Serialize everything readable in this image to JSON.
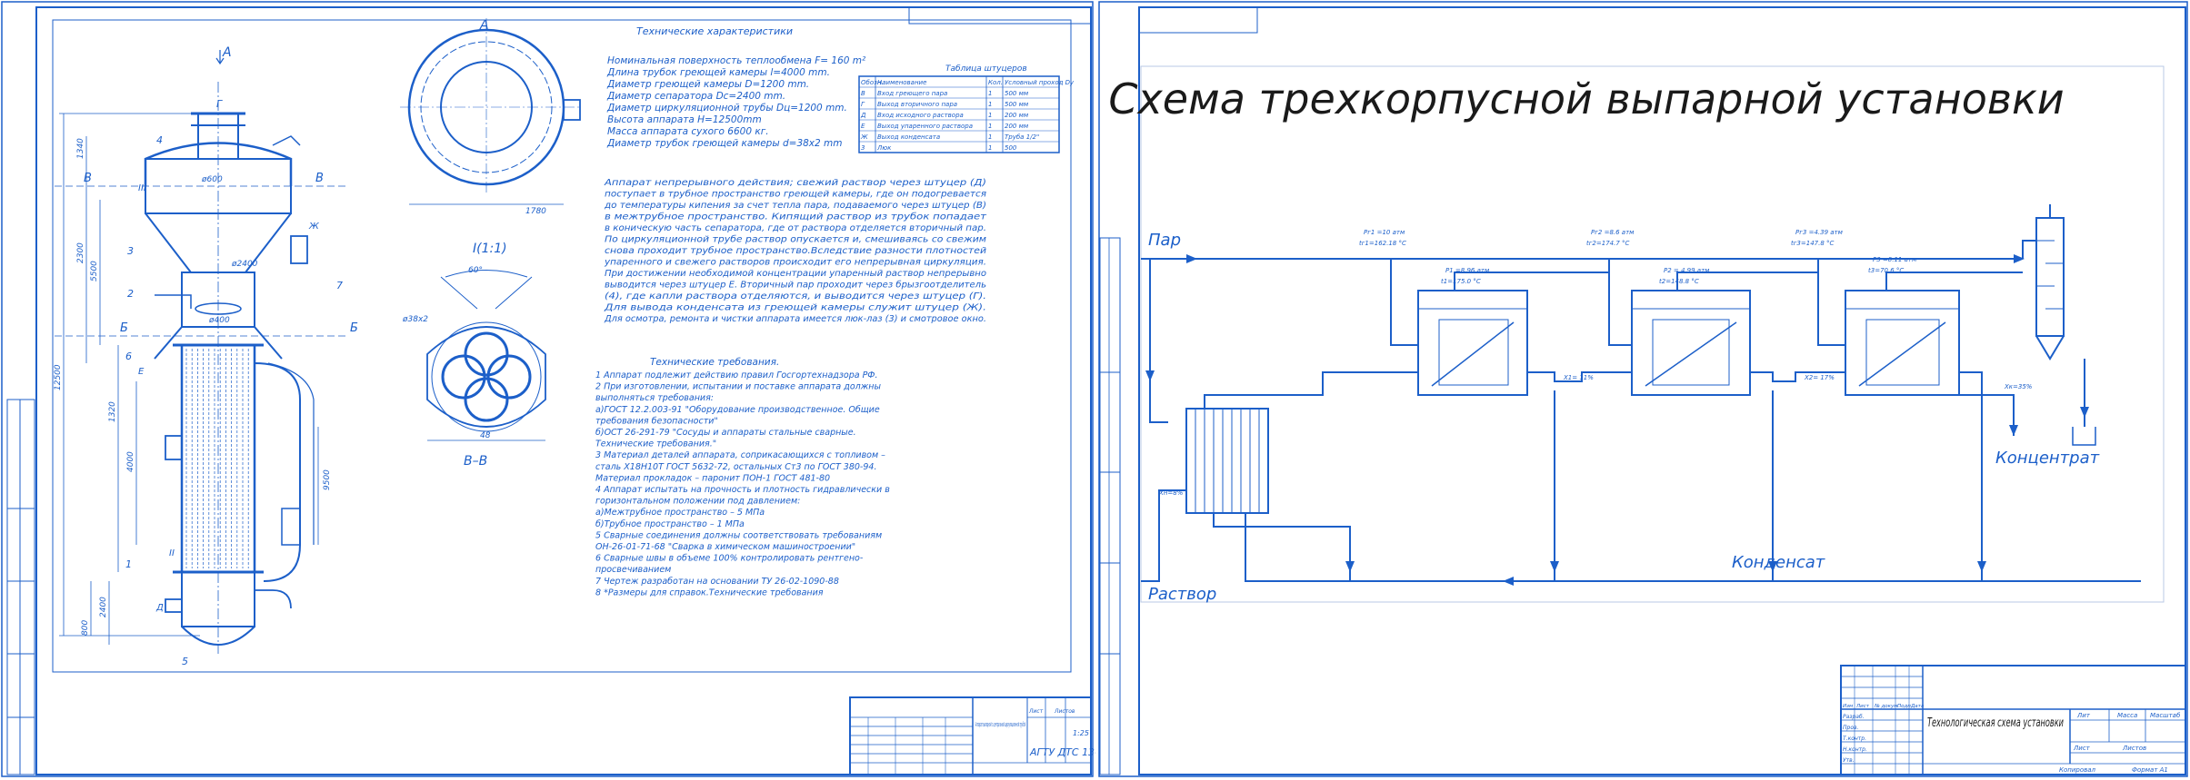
{
  "sheet1": {
    "section_marks": {
      "a_arrow": "A",
      "a_top": "A",
      "v_left": "B",
      "v_right": "B",
      "b_left": "Б",
      "b_right": "Б",
      "g": "Г",
      "e": "E",
      "d": "Д",
      "zh": "Ж",
      "view": "I(1:1)",
      "vv": "B–B"
    },
    "tech_title": "Технические характеристики",
    "specs": [
      "Номинальная поверхность теплообмена F= 160 m²",
      "Длина трубок греющей камеры l=4000 mm.",
      "Диаметр греющей камеры D=1200 mm.",
      "Диаметр сепаратора Dс=2400 mm.",
      "Диаметр циркуляционной трубы Dц=1200 mm.",
      "Высота аппарата H=12500mm",
      "Масса аппарата сухого 6600 кг.",
      "Диаметр трубок греющей камеры d=38x2 mm"
    ],
    "description": [
      "Аппарат непрерывного действия; свежий раствор через штуцер (Д)",
      "поступает в трубное пространство греющей камеры, где он подогревается",
      "до температуры кипения за счет тепла пара, подаваемого через штуцер (В)",
      "в межтрубное пространство. Кипящий раствор из трубок попадает",
      "в коническую часть сепаратора, где от раствора отделяется вторичный пар.",
      "По циркуляционной трубе раствор опускается и, смешиваясь со свежим",
      "снова проходит трубное пространство.Вследствие разности плотностей",
      "упаренного и свежего растворов происходит его непрерывная циркуляция.",
      "При достижении необходимой концентрации упаренный раствор непрерывно",
      "выводится через штуцер Е. Вторичный пар проходит через брызгоотделитель",
      "(4), где капли раствора отделяются, и выводится через штуцер (Г).",
      "Для вывода конденсата из греющей камеры служит штуцер (Ж).",
      "Для осмотра, ремонта и чистки аппарата имеется люк-лаз (3) и смотровое окно."
    ],
    "req_title": "Технические требования.",
    "requirements": [
      "1 Аппарат подлежит действию правил Госгортехнадзора РФ.",
      "2 При изготовлении, испытании и поставке аппарата должны",
      "выполняться требования:",
      "    а)ГОСТ 12.2.003-91 \"Оборудование производственное. Общие",
      "    требования безопасности\"",
      "    б)ОСТ 26-291-79 \"Сосуды и аппараты стальные сварные.",
      "Технические требования.\"",
      "3 Материал деталей аппарата, соприкасающихся с топливом –",
      "сталь Х18Н10Т ГОСТ 5632-72, остальных Ст3 по ГОСТ 380-94.",
      "Материал прокладок – паронит ПОН-1 ГОСТ 481-80",
      "4 Аппарат испытать на прочность и плотность гидравлически в",
      "горизонтальном положении под давлением:",
      "    а)Межтрубное пространство –   5 МПа",
      "    б)Трубное пространство –      1 МПа",
      "5 Сварные соединения должны соответствовать требованиям",
      "ОН-26-01-71-68 \"Сварка в химическом машиностроении\"",
      "6 Сварные швы в объеме 100% контролировать рентгено-",
      "просвечиванием",
      "7 Чертеж разработан на основании ТУ 26-02-1090-88",
      "8 *Размеры для справок.Технические требования"
    ],
    "nozzle_table": {
      "title": "Таблица штуцеров",
      "headers": [
        "Обозн.",
        "Наименование",
        "Кол.",
        "Условный проход Dу"
      ],
      "rows": [
        [
          "В",
          "Вход греющего пара",
          "1",
          "500 мм"
        ],
        [
          "Г",
          "Выход вторичного пара",
          "1",
          "500 мм"
        ],
        [
          "Д",
          "Вход исходного раствора",
          "1",
          "200 мм"
        ],
        [
          "Е",
          "Выход упаренного раствора",
          "1",
          "200 мм"
        ],
        [
          "Ж",
          "Выход конденсата",
          "1",
          "Труба 1/2\""
        ],
        [
          "3",
          "Люк",
          "1",
          "500"
        ]
      ]
    },
    "dims": {
      "h_total": "12500",
      "h1": "1340",
      "h2": "2300",
      "h3": "5500",
      "h4": "1320",
      "h5": "4000",
      "h6": "9500",
      "h7": "2400",
      "h8": "800",
      "d1": "ø600",
      "d2": "ø2400",
      "d3": "ø400",
      "d4": "ø38х2",
      "top_w": "1780",
      "ang": "60°",
      "pitch": "48"
    },
    "labels": {
      "n1": "1",
      "n2": "2",
      "n3": "3",
      "n4": "4",
      "n5": "5",
      "n6": "6",
      "n7": "7",
      "roman2": "II",
      "roman3": "III"
    },
    "stamp": {
      "doc": "АГТУ ДТС 13-4-1",
      "title": "Аппарат выпарной с центральной циркуляционной трубой",
      "scale": "1:25",
      "sheet": "Лист",
      "sheets": "Листов"
    }
  },
  "sheet2": {
    "title": "Схема трехкорпусной выпарной установки",
    "labels": {
      "steam": "Пар",
      "solution": "Раствор",
      "condensate": "Конденсат",
      "concentrate": "Концентрат"
    },
    "annotations": [
      "Рг1 =10 атм",
      "tг1=162.18 °C",
      "Р1 =8.96 атм",
      "t1=175.0 °C",
      "Рг2 =8.6 атм",
      "tг2=174.7 °C",
      "Р2 = 4.99 атм",
      "t2=148.8 °C",
      "Рг3 =4.39 атм",
      "tг3=147.8 °C",
      "Р3 =0.11 атм",
      "t3=70.6 °C",
      "Xн=8%",
      "X1= 11%",
      "X2= 17%",
      "Xк=35%"
    ],
    "stamp_title": "Технологическая схема установки",
    "stamp_cols": [
      "Лит",
      "Масса",
      "Масштаб"
    ],
    "stamp_sheet": "Лист",
    "stamp_sheets": "Листов",
    "format": "Формат А1",
    "copied": "Копировал",
    "rows": [
      "Изм",
      "Лист",
      "№ докум.",
      "Подп.",
      "Дата",
      "Разраб.",
      "Пров.",
      "Т.контр.",
      "Н.контр.",
      "Утв."
    ]
  }
}
